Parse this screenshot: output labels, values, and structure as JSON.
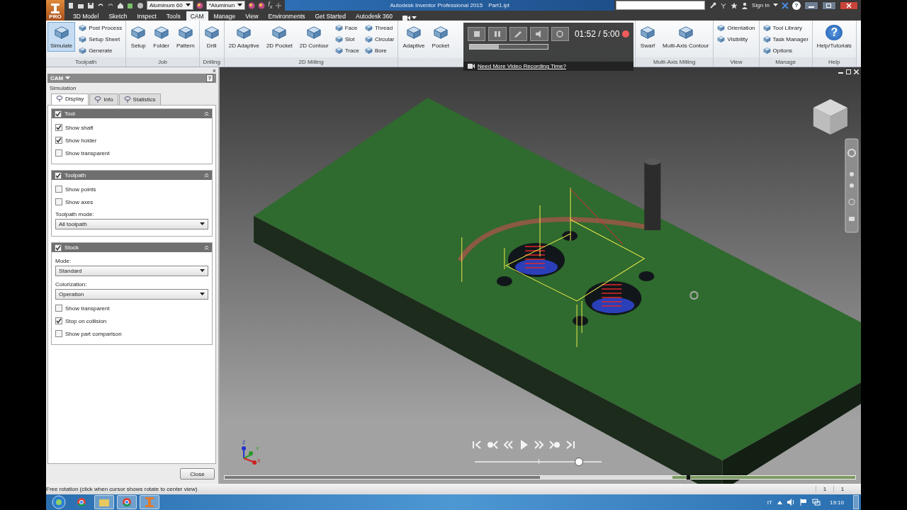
{
  "app_button": {
    "badge": "PRO"
  },
  "quick_access": {
    "material": "Aluminum 60",
    "appearance": "*Aluminun",
    "function_label": "f$_{x}$"
  },
  "title_bar": {
    "title": "Autodesk Inventor Professional 2015",
    "document": "Part1.ipt",
    "sign_in": "Sign In",
    "help": "?"
  },
  "ribbon_tabs": [
    {
      "label": "3D Model",
      "selected": false
    },
    {
      "label": "Sketch",
      "selected": false
    },
    {
      "label": "Inspect",
      "selected": false
    },
    {
      "label": "Tools",
      "selected": false
    },
    {
      "label": "CAM",
      "selected": true
    },
    {
      "label": "Manage",
      "selected": false
    },
    {
      "label": "View",
      "selected": false
    },
    {
      "label": "Environments",
      "selected": false
    },
    {
      "label": "Get Started",
      "selected": false
    },
    {
      "label": "Autodesk 360",
      "selected": false
    }
  ],
  "ribbon_groups": [
    {
      "label": "Toolpath",
      "items": [
        {
          "kind": "large",
          "label": "Simulate",
          "active": true
        },
        {
          "kind": "column",
          "entries": [
            "Post Process",
            "Setup Sheet",
            "Generate"
          ]
        }
      ]
    },
    {
      "label": "Job",
      "items": [
        {
          "kind": "large",
          "label": "Setup",
          "active": false
        },
        {
          "kind": "large",
          "label": "Folder",
          "active": false
        },
        {
          "kind": "large",
          "label": "Pattern",
          "active": false
        }
      ]
    },
    {
      "label": "Drilling",
      "items": [
        {
          "kind": "large",
          "label": "Drill",
          "active": false
        }
      ]
    },
    {
      "label": "2D Milling",
      "items": [
        {
          "kind": "large",
          "label": "2D Adaptive",
          "active": false
        },
        {
          "kind": "large",
          "label": "2D Pocket",
          "active": false
        },
        {
          "kind": "large",
          "label": "2D Contour",
          "active": false
        },
        {
          "kind": "column",
          "entries": [
            "Face",
            "Slot",
            "Trace"
          ]
        },
        {
          "kind": "column",
          "entries": [
            "Thread",
            "Circular",
            "Bore"
          ]
        }
      ]
    },
    {
      "items": [
        {
          "kind": "large",
          "label": "Adaptive",
          "active": false
        },
        {
          "kind": "large",
          "label": "Pocket",
          "active": false
        }
      ],
      "recording_overlay": {
        "time": "01:52 / 5:00",
        "level": 0.37,
        "link": "Need More Video Recording Time?"
      }
    },
    {
      "label": "Multi-Axis Milling",
      "items": [
        {
          "kind": "large",
          "label": "Swarf",
          "active": false
        },
        {
          "kind": "large",
          "label": "Multi-Axis Contour",
          "active": false
        }
      ]
    },
    {
      "label": "View",
      "items": [
        {
          "kind": "column",
          "entries": [
            "Orientation",
            "Visibility"
          ]
        }
      ]
    },
    {
      "label": "Manage",
      "items": [
        {
          "kind": "column",
          "entries": [
            "Tool Library",
            "Task Manager",
            "Options"
          ]
        }
      ]
    },
    {
      "label": "Help",
      "items": [
        {
          "kind": "help",
          "label": "Help/Tutorials",
          "glyph": "?"
        }
      ]
    }
  ],
  "browser_panel": {
    "header": "CAM",
    "help": "?",
    "subtitle": "Simulation",
    "close_mark": "×",
    "tabs": [
      {
        "label": "Display",
        "selected": true
      },
      {
        "label": "Info",
        "selected": false
      },
      {
        "label": "Statistics",
        "selected": false
      }
    ],
    "sections": [
      {
        "title": "Tool",
        "checked": true,
        "expanded": true,
        "rows": [
          {
            "kind": "checkbox",
            "label": "Show shaft",
            "checked": true
          },
          {
            "kind": "checkbox",
            "label": "Show holder",
            "checked": true
          },
          {
            "kind": "checkbox",
            "label": "Show transparent",
            "checked": false
          }
        ]
      },
      {
        "title": "Toolpath",
        "checked": true,
        "expanded": true,
        "rows": [
          {
            "kind": "checkbox",
            "label": "Show points",
            "checked": false
          },
          {
            "kind": "checkbox",
            "label": "Show axes",
            "checked": false
          },
          {
            "kind": "select",
            "label": "Toolpath mode:",
            "value": "All toolpath"
          }
        ]
      },
      {
        "title": "Stock",
        "checked": true,
        "expanded": true,
        "rows": [
          {
            "kind": "select",
            "label": "Mode:",
            "value": "Standard"
          },
          {
            "kind": "select",
            "label": "Colorization:",
            "value": "Operation"
          },
          {
            "kind": "checkbox",
            "label": "Show transparent",
            "checked": false
          },
          {
            "kind": "checkbox",
            "label": "Stop on collision",
            "checked": true
          },
          {
            "kind": "checkbox",
            "label": "Show part comparison",
            "checked": false
          }
        ]
      }
    ],
    "close_button": "Close"
  },
  "viewport": {
    "axis_labels": [
      "Z",
      "Y",
      "X"
    ],
    "playback": {
      "level": 0.82
    }
  },
  "status_bar": {
    "message": "Free rotation (click when cursor shows rotate to center view)",
    "counts": [
      "1",
      "1"
    ]
  },
  "taskbar": {
    "language": "IT",
    "clock": "19:10"
  }
}
